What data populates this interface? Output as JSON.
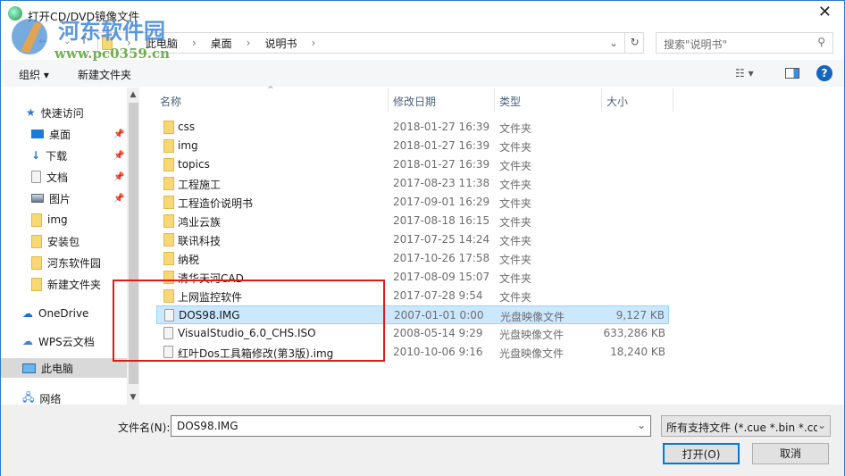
{
  "window": {
    "title": "打开CD/DVD镜像文件",
    "close": "✕"
  },
  "watermark": {
    "name": "河东软件园",
    "url": "www.pc0359.cn"
  },
  "address": {
    "crumbs": [
      "此电脑",
      "桌面",
      "说明书"
    ],
    "search_placeholder": "搜索\"说明书\""
  },
  "toolbar": {
    "organize": "组织 ▾",
    "new_folder": "新建文件夹",
    "help": "?"
  },
  "sidebar": {
    "quick_access": "快速访问",
    "items": [
      {
        "label": "桌面",
        "pinned": true
      },
      {
        "label": "下载",
        "pinned": true
      },
      {
        "label": "文档",
        "pinned": true
      },
      {
        "label": "图片",
        "pinned": true
      },
      {
        "label": "img"
      },
      {
        "label": "安装包"
      },
      {
        "label": "河东软件园"
      },
      {
        "label": "新建文件夹"
      }
    ],
    "onedrive": "OneDrive",
    "wps": "WPS云文档",
    "this_pc": "此电脑",
    "network": "网络"
  },
  "columns": {
    "name": "名称",
    "date": "修改日期",
    "type": "类型",
    "size": "大小"
  },
  "files": [
    {
      "name": "css",
      "date": "2018-01-27 16:39",
      "type": "文件夹",
      "size": "",
      "kind": "folder"
    },
    {
      "name": "img",
      "date": "2018-01-27 16:39",
      "type": "文件夹",
      "size": "",
      "kind": "folder"
    },
    {
      "name": "topics",
      "date": "2018-01-27 16:39",
      "type": "文件夹",
      "size": "",
      "kind": "folder"
    },
    {
      "name": "工程施工",
      "date": "2017-08-23 11:38",
      "type": "文件夹",
      "size": "",
      "kind": "folder"
    },
    {
      "name": "工程造价说明书",
      "date": "2017-09-01 16:29",
      "type": "文件夹",
      "size": "",
      "kind": "folder"
    },
    {
      "name": "鸿业云族",
      "date": "2017-08-18 16:15",
      "type": "文件夹",
      "size": "",
      "kind": "folder"
    },
    {
      "name": "联讯科技",
      "date": "2017-07-25 14:24",
      "type": "文件夹",
      "size": "",
      "kind": "folder"
    },
    {
      "name": "纳税",
      "date": "2017-10-26 17:58",
      "type": "文件夹",
      "size": "",
      "kind": "folder"
    },
    {
      "name": "清华天河CAD",
      "date": "2017-08-09 15:07",
      "type": "文件夹",
      "size": "",
      "kind": "folder"
    },
    {
      "name": "上网监控软件",
      "date": "2017-07-28 9:54",
      "type": "文件夹",
      "size": "",
      "kind": "folder"
    },
    {
      "name": "DOS98.IMG",
      "date": "2007-01-01 0:00",
      "type": "光盘映像文件",
      "size": "9,127 KB",
      "kind": "file",
      "selected": true
    },
    {
      "name": "VisualStudio_6.0_CHS.ISO",
      "date": "2008-05-14 9:29",
      "type": "光盘映像文件",
      "size": "633,286 KB",
      "kind": "file"
    },
    {
      "name": "红叶Dos工具箱修改(第3版).img",
      "date": "2010-10-06 9:16",
      "type": "光盘映像文件",
      "size": "18,240 KB",
      "kind": "file"
    }
  ],
  "bottom": {
    "filename_label": "文件名(N):",
    "filename": "DOS98.IMG",
    "filetype": "所有支持文件 (*.cue *.bin *.cd",
    "open": "打开(O)",
    "cancel": "取消"
  }
}
